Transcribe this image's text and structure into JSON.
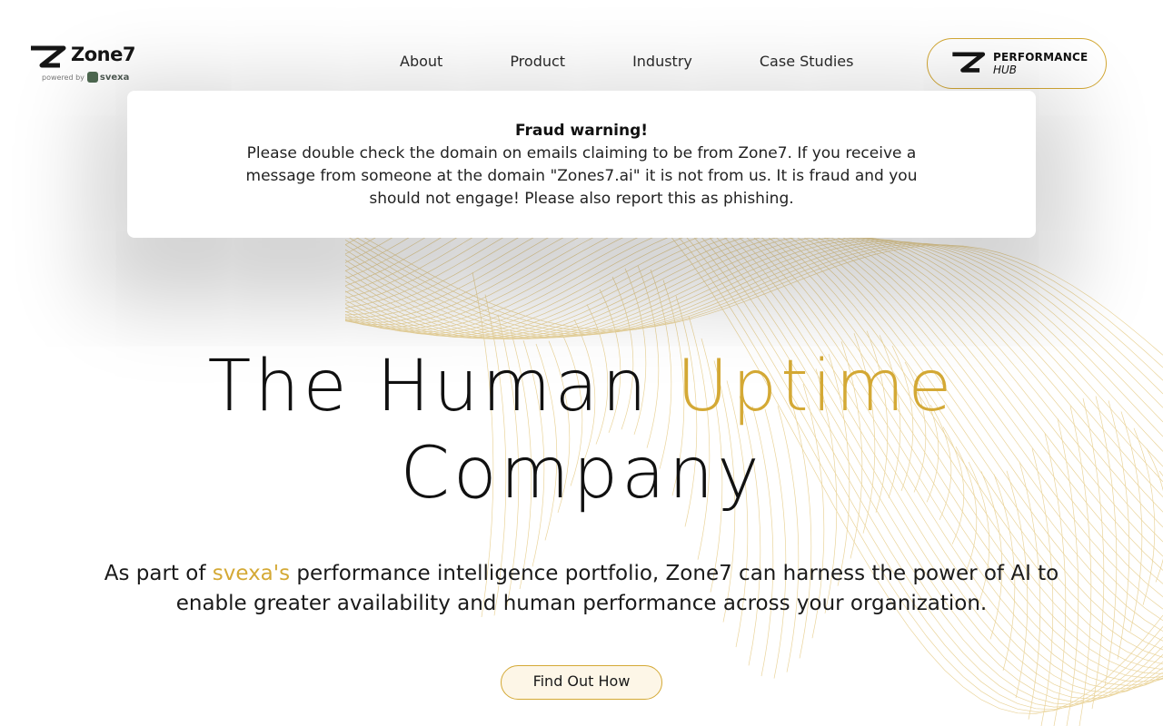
{
  "brand": {
    "name": "Zone7",
    "powered_by": "powered by",
    "parent_brand": "svexa"
  },
  "nav": {
    "items": [
      {
        "label": "About"
      },
      {
        "label": "Product"
      },
      {
        "label": "Industry"
      },
      {
        "label": "Case Studies"
      }
    ]
  },
  "performance_hub": {
    "line1": "PERFORMANCE",
    "line2": "HUB"
  },
  "notice": {
    "title": "Fraud warning!",
    "body": "Please double check the domain on emails claiming to be from Zone7. If you receive a message from someone at the domain \"Zones7.ai\" it is not from us. It is fraud and you should not engage! Please also report this as phishing."
  },
  "hero": {
    "title_part1": "The Human ",
    "title_accent": "Uptime",
    "title_part2": "Company",
    "lede_prefix": "As part of ",
    "lede_link": "svexa's",
    "lede_suffix": " performance intelligence portfolio, Zone7 can harness the power of AI to enable greater availability and human performance across your organization.",
    "cta_label": "Find Out How"
  },
  "colors": {
    "accent": "#d4a935",
    "text": "#111111",
    "background": "#ffffff"
  }
}
